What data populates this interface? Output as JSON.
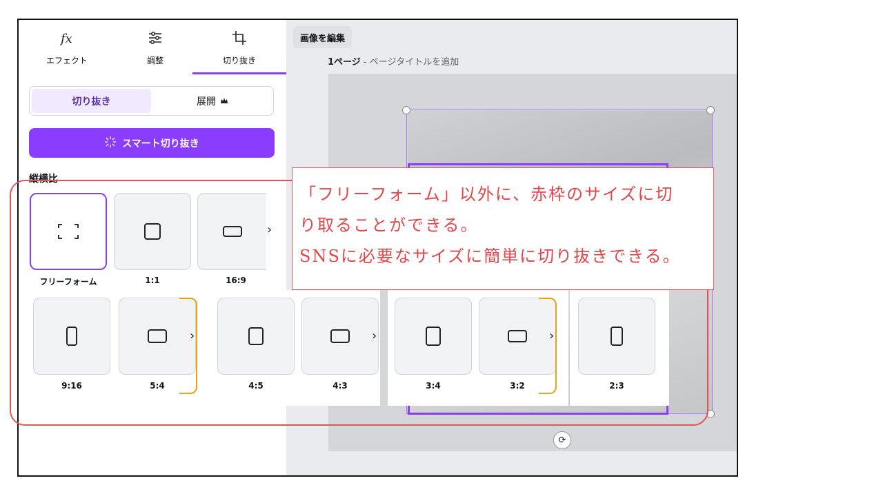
{
  "tabs": [
    {
      "label": "エフェクト",
      "icon": "fx-icon"
    },
    {
      "label": "調整",
      "icon": "sliders-icon"
    },
    {
      "label": "切り抜き",
      "icon": "crop-icon"
    }
  ],
  "crop_mode": {
    "crop_label": "切り抜き",
    "expand_label": "展開"
  },
  "smart_crop_label": "スマート切り抜き",
  "aspect_title": "縦横比",
  "ratios_row1": [
    "フリーフォーム",
    "1:1",
    "16:9"
  ],
  "ratios_strip": [
    "9:16",
    "5:4",
    "4:5",
    "4:3",
    "3:4",
    "3:2",
    "2:3"
  ],
  "canvas": {
    "edit_button": "画像を編集",
    "page_number": "1ページ",
    "page_title_placeholder": " - ページタイトルを追加"
  },
  "annotation": {
    "line1": "「フリーフォーム」以外に、赤枠のサイズに切",
    "line2": "り取ることができる。",
    "line3": "SNSに必要なサイズに簡単に切り抜きできる。"
  },
  "colors": {
    "accent": "#8b3dff",
    "annotation_red": "#e05555",
    "highlight_orange": "#e8a317"
  }
}
